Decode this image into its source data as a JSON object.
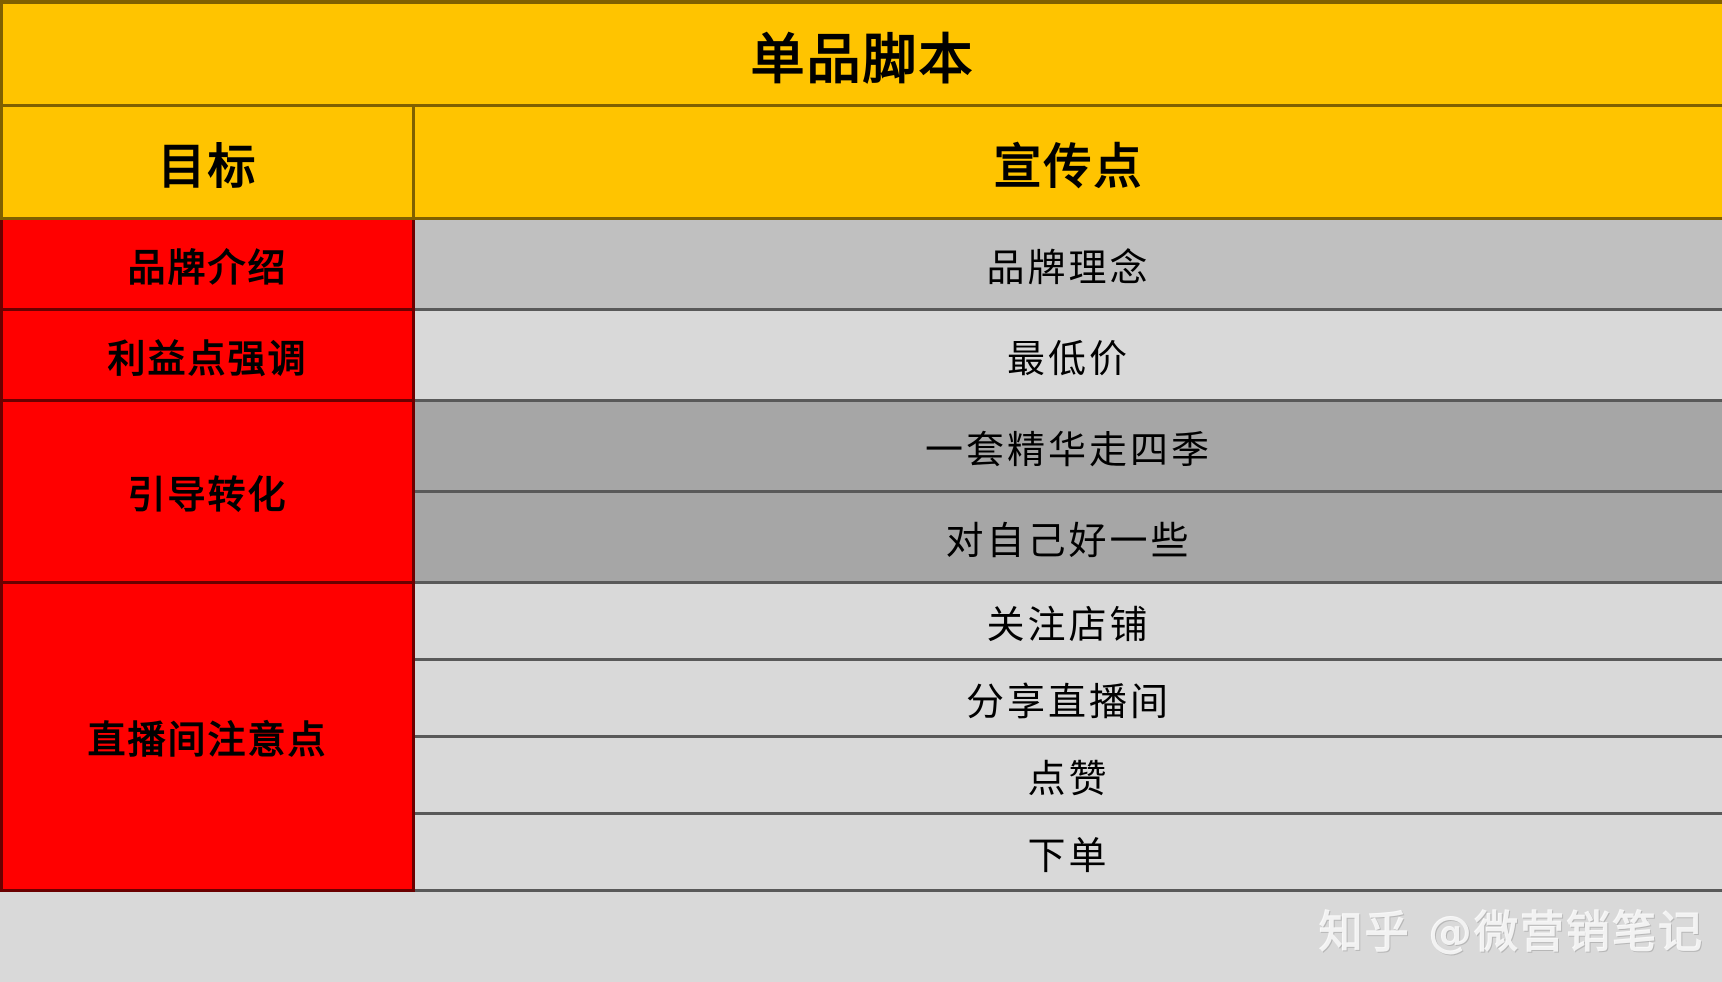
{
  "table": {
    "title": "单品脚本",
    "columns": [
      {
        "key": "goal",
        "label": "目标"
      },
      {
        "key": "point",
        "label": "宣传点"
      }
    ],
    "groups": [
      {
        "goal": "品牌介绍",
        "tone": "dark",
        "points": [
          "品牌理念"
        ]
      },
      {
        "goal": "利益点强调",
        "tone": "light",
        "points": [
          "最低价"
        ]
      },
      {
        "goal": "引导转化",
        "tone": "medium",
        "points": [
          "一套精华走四季",
          "对自己好一些"
        ]
      },
      {
        "goal": "直播间注意点",
        "tone": "light",
        "points": [
          "关注店铺",
          "分享直播间",
          "点赞",
          "下单"
        ]
      }
    ]
  },
  "watermark": {
    "text": "知乎 @微营销笔记"
  },
  "colors": {
    "header_yellow": "#FFC400",
    "header_border": "#806000",
    "goal_red": "#FF0000",
    "goal_border": "#6B0000",
    "point_border": "#595959",
    "tone_dark": "#C0C0C0",
    "tone_medium": "#A6A6A6",
    "tone_light": "#D9D9D9",
    "text_black": "#000000",
    "watermark_white": "#FFFFFF"
  }
}
